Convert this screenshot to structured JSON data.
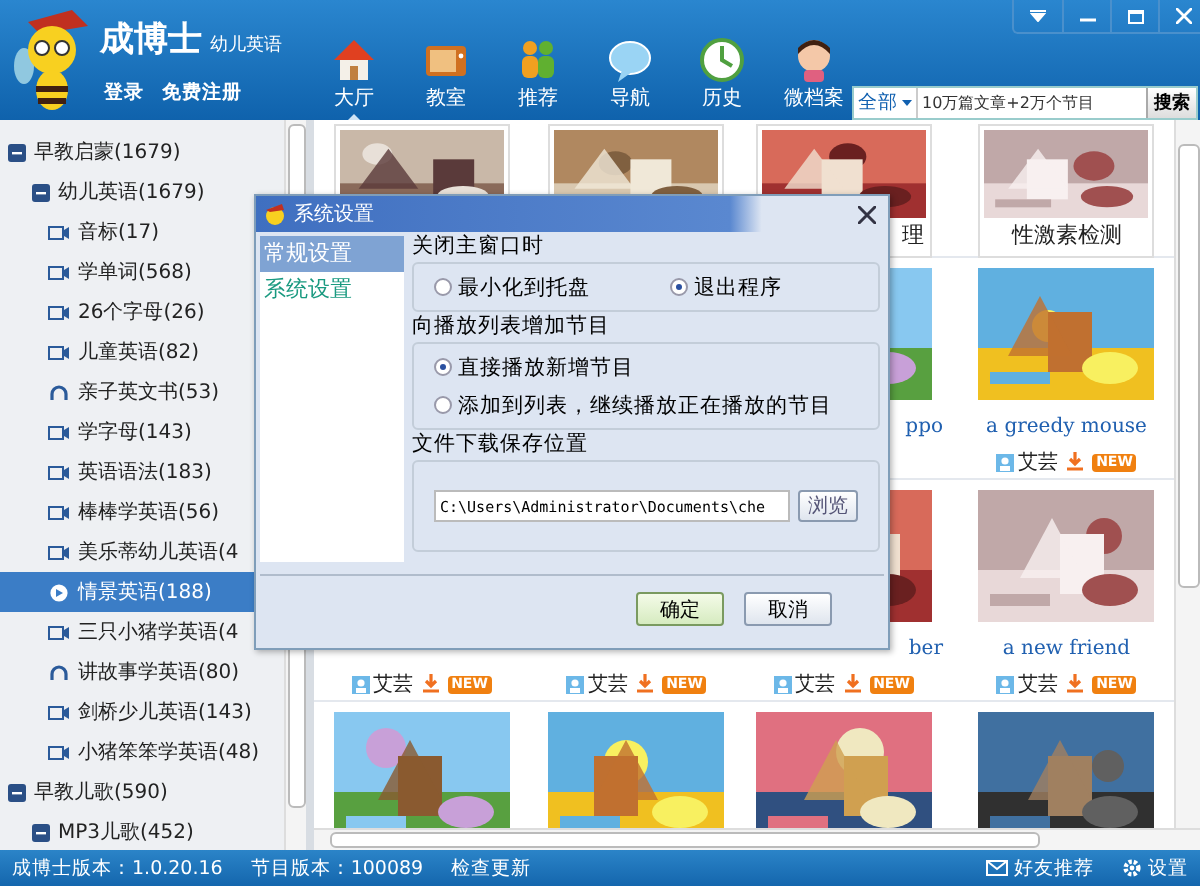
{
  "app": {
    "name": "成博士",
    "subtitle": "幼儿英语",
    "login": "登录",
    "register": "免费注册"
  },
  "nav": [
    {
      "label": "大厅",
      "kind": "home",
      "selected": true
    },
    {
      "label": "教室",
      "kind": "tv",
      "selected": false
    },
    {
      "label": "推荐",
      "kind": "people",
      "selected": false
    },
    {
      "label": "导航",
      "kind": "bubble",
      "selected": false
    },
    {
      "label": "历史",
      "kind": "history",
      "selected": false
    },
    {
      "label": "微档案",
      "kind": "doll",
      "selected": false
    }
  ],
  "search": {
    "scope": "全部",
    "placeholder": "10万篇文章+2万个节目",
    "button": "搜索"
  },
  "sidebar": {
    "items": [
      {
        "label": "早教启蒙(1679)",
        "expanded": true,
        "children": [
          {
            "label": "幼儿英语(1679)",
            "expanded": true,
            "children": [
              {
                "label": "音标(17)",
                "kind": "video",
                "selected": false
              },
              {
                "label": "学单词(568)",
                "kind": "video",
                "selected": false
              },
              {
                "label": "26个字母(26)",
                "kind": "video",
                "selected": false
              },
              {
                "label": "儿童英语(82)",
                "kind": "video",
                "selected": false
              },
              {
                "label": "亲子英文书(53)",
                "kind": "audio",
                "selected": false
              },
              {
                "label": "学字母(143)",
                "kind": "video",
                "selected": false
              },
              {
                "label": "英语语法(183)",
                "kind": "video",
                "selected": false
              },
              {
                "label": "棒棒学英语(56)",
                "kind": "video",
                "selected": false
              },
              {
                "label": "美乐蒂幼儿英语(4",
                "kind": "video",
                "selected": false
              },
              {
                "label": "情景英语(188)",
                "kind": "video",
                "selected": true
              },
              {
                "label": "三只小猪学英语(4",
                "kind": "video",
                "selected": false
              },
              {
                "label": "讲故事学英语(80)",
                "kind": "audio",
                "selected": false
              },
              {
                "label": "剑桥少儿英语(143)",
                "kind": "video",
                "selected": false
              },
              {
                "label": "小猪笨笨学英语(48)",
                "kind": "video",
                "selected": false
              }
            ]
          }
        ]
      },
      {
        "label": "早教儿歌(590)",
        "expanded": true,
        "children": [
          {
            "label": "MP3儿歌(452)",
            "expanded": true
          }
        ]
      }
    ]
  },
  "content": {
    "rows": [
      {
        "kind": "article",
        "cards": [
          {
            "image": {
              "kind": "picture"
            }
          },
          {
            "image": {
              "kind": "picture"
            }
          },
          {
            "image": {
              "kind": "picture"
            },
            "caption": "理"
          },
          {
            "image": {
              "kind": "picture"
            },
            "caption": "性激素检测"
          }
        ]
      },
      {
        "kind": "video",
        "cards": [
          {
            "image": {
              "kind": "picture"
            },
            "caption": "ppo"
          },
          {
            "image": {
              "kind": "picture"
            },
            "caption": "a greedy mouse",
            "author": "艾芸",
            "badge": "NEW"
          }
        ]
      },
      {
        "kind": "video",
        "cards": [
          {
            "author": "艾芸",
            "badge": "NEW"
          },
          {
            "author": "艾芸",
            "badge": "NEW"
          },
          {
            "image": {
              "kind": "picture"
            },
            "caption": "ber",
            "author": "艾芸",
            "badge": "NEW"
          },
          {
            "image": {
              "kind": "picture"
            },
            "caption": "a new friend",
            "author": "艾芸",
            "badge": "NEW"
          }
        ]
      },
      {
        "kind": "video",
        "cards": [
          {
            "image": {
              "kind": "picture"
            }
          },
          {
            "image": {
              "kind": "picture"
            }
          },
          {
            "image": {
              "kind": "picture"
            }
          },
          {
            "image": {
              "kind": "picture"
            }
          }
        ]
      }
    ]
  },
  "dialog": {
    "title": "系统设置",
    "categories": [
      {
        "label": "常规设置",
        "selected": true
      },
      {
        "label": "系统设置",
        "selected": false
      }
    ],
    "groups": [
      {
        "title": "关闭主窗口时",
        "kind": "inline",
        "options": [
          {
            "label": "最小化到托盘",
            "selected": false
          },
          {
            "label": "退出程序",
            "selected": true
          }
        ]
      },
      {
        "title": "向播放列表增加节目",
        "kind": "stacked",
        "options": [
          {
            "label": "直接播放新增节目",
            "selected": true
          },
          {
            "label": "添加到列表，继续播放正在播放的节目",
            "selected": false
          }
        ]
      },
      {
        "title": "文件下载保存位置",
        "kind": "path",
        "value": "C:\\Users\\Administrator\\Documents\\che",
        "button": "浏览"
      }
    ],
    "buttons": [
      {
        "label": "确定",
        "default": true
      },
      {
        "label": "取消",
        "default": false
      }
    ]
  },
  "status_bar": {
    "app_version": "成博士版本：1.0.20.16",
    "program_version": "节目版本：100089",
    "update": "检查更新",
    "share": "好友推荐",
    "settings": "设置"
  }
}
